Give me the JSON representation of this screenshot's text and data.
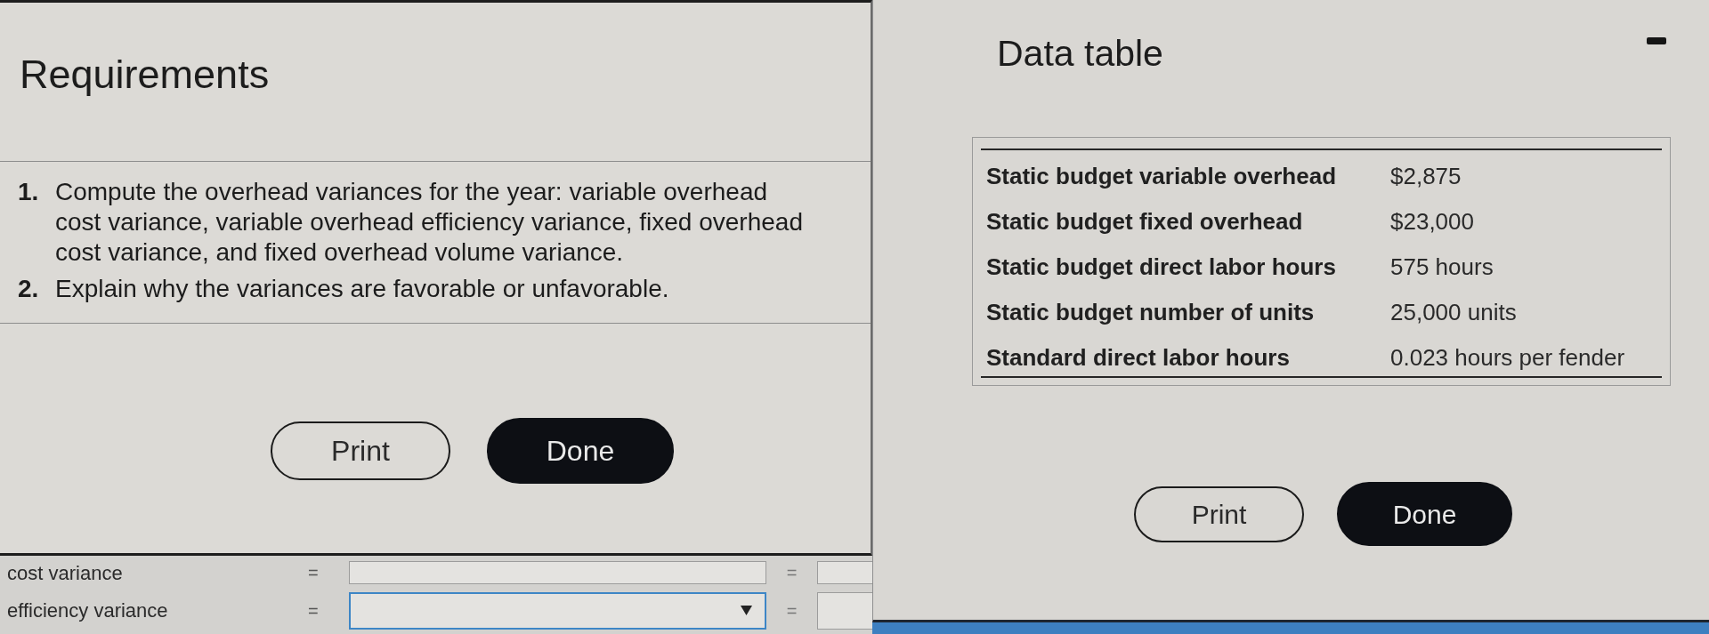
{
  "requirements": {
    "title": "Requirements",
    "items": [
      {
        "number": "1.",
        "text": "Compute the overhead variances for the year: variable overhead cost variance, variable overhead efficiency variance, fixed overhead cost variance, and fixed overhead volume variance."
      },
      {
        "number": "2.",
        "text": "Explain why the variances are favorable or unfavorable."
      }
    ],
    "buttons": [
      {
        "label": "Print",
        "kind": "outline"
      },
      {
        "label": "Done",
        "kind": "filled"
      }
    ]
  },
  "data_table": {
    "title": "Data table",
    "rows": [
      {
        "label": "Static budget variable overhead",
        "value": "$2,875"
      },
      {
        "label": "Static budget fixed overhead",
        "value": "$23,000"
      },
      {
        "label": "Static budget direct labor hours",
        "value": "575 hours"
      },
      {
        "label": "Static budget number of units",
        "value": "25,000 units"
      },
      {
        "label": "Standard direct labor hours",
        "value": "0.023 hours per fender"
      }
    ],
    "buttons": [
      {
        "label": "Print",
        "kind": "outline"
      },
      {
        "label": "Done",
        "kind": "filled"
      }
    ]
  },
  "worksheet": {
    "rows": [
      {
        "label": "cost variance",
        "operator": "=",
        "kind": "input",
        "focused": false,
        "result_operator": "="
      },
      {
        "label": "efficiency variance",
        "operator": "=",
        "kind": "select",
        "focused": true,
        "result_operator": "="
      }
    ]
  }
}
